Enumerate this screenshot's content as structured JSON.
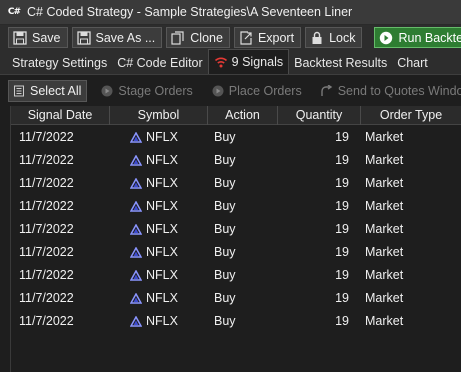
{
  "window": {
    "title": "C# Coded Strategy - Sample Strategies\\A Seventeen Liner",
    "app_icon_text": "C#"
  },
  "toolbar": {
    "save_label": "Save",
    "save_as_label": "Save As ...",
    "clone_label": "Clone",
    "export_label": "Export",
    "lock_label": "Lock",
    "run_backtest_label": "Run Backtest"
  },
  "tabs": [
    {
      "label": "Strategy Settings"
    },
    {
      "label": "C# Code Editor"
    },
    {
      "label": "9 Signals"
    },
    {
      "label": "Backtest Results"
    },
    {
      "label": "Chart"
    }
  ],
  "subtoolbar": {
    "select_all_label": "Select All",
    "stage_orders_label": "Stage Orders",
    "place_orders_label": "Place Orders",
    "send_quotes_label": "Send to Quotes Window"
  },
  "grid": {
    "columns": [
      "Signal Date",
      "Symbol",
      "Action",
      "Quantity",
      "Order Type"
    ],
    "rows": [
      {
        "date": "11/7/2022",
        "symbol": "NFLX",
        "action": "Buy",
        "quantity": "19",
        "order_type": "Market"
      },
      {
        "date": "11/7/2022",
        "symbol": "NFLX",
        "action": "Buy",
        "quantity": "19",
        "order_type": "Market"
      },
      {
        "date": "11/7/2022",
        "symbol": "NFLX",
        "action": "Buy",
        "quantity": "19",
        "order_type": "Market"
      },
      {
        "date": "11/7/2022",
        "symbol": "NFLX",
        "action": "Buy",
        "quantity": "19",
        "order_type": "Market"
      },
      {
        "date": "11/7/2022",
        "symbol": "NFLX",
        "action": "Buy",
        "quantity": "19",
        "order_type": "Market"
      },
      {
        "date": "11/7/2022",
        "symbol": "NFLX",
        "action": "Buy",
        "quantity": "19",
        "order_type": "Market"
      },
      {
        "date": "11/7/2022",
        "symbol": "NFLX",
        "action": "Buy",
        "quantity": "19",
        "order_type": "Market"
      },
      {
        "date": "11/7/2022",
        "symbol": "NFLX",
        "action": "Buy",
        "quantity": "19",
        "order_type": "Market"
      },
      {
        "date": "11/7/2022",
        "symbol": "NFLX",
        "action": "Buy",
        "quantity": "19",
        "order_type": "Market"
      }
    ]
  },
  "colors": {
    "accent_green": "#2e7d32",
    "signal_icon_red": "#e53935",
    "symbol_triangle": "#6f7fff"
  },
  "icons": [
    "save-icon",
    "save-as-icon",
    "clone-icon",
    "export-icon",
    "lock-icon",
    "play-icon",
    "signal-icon",
    "select-all-icon",
    "stage-orders-icon",
    "place-orders-icon",
    "send-quotes-icon",
    "symbol-triangle-icon"
  ]
}
